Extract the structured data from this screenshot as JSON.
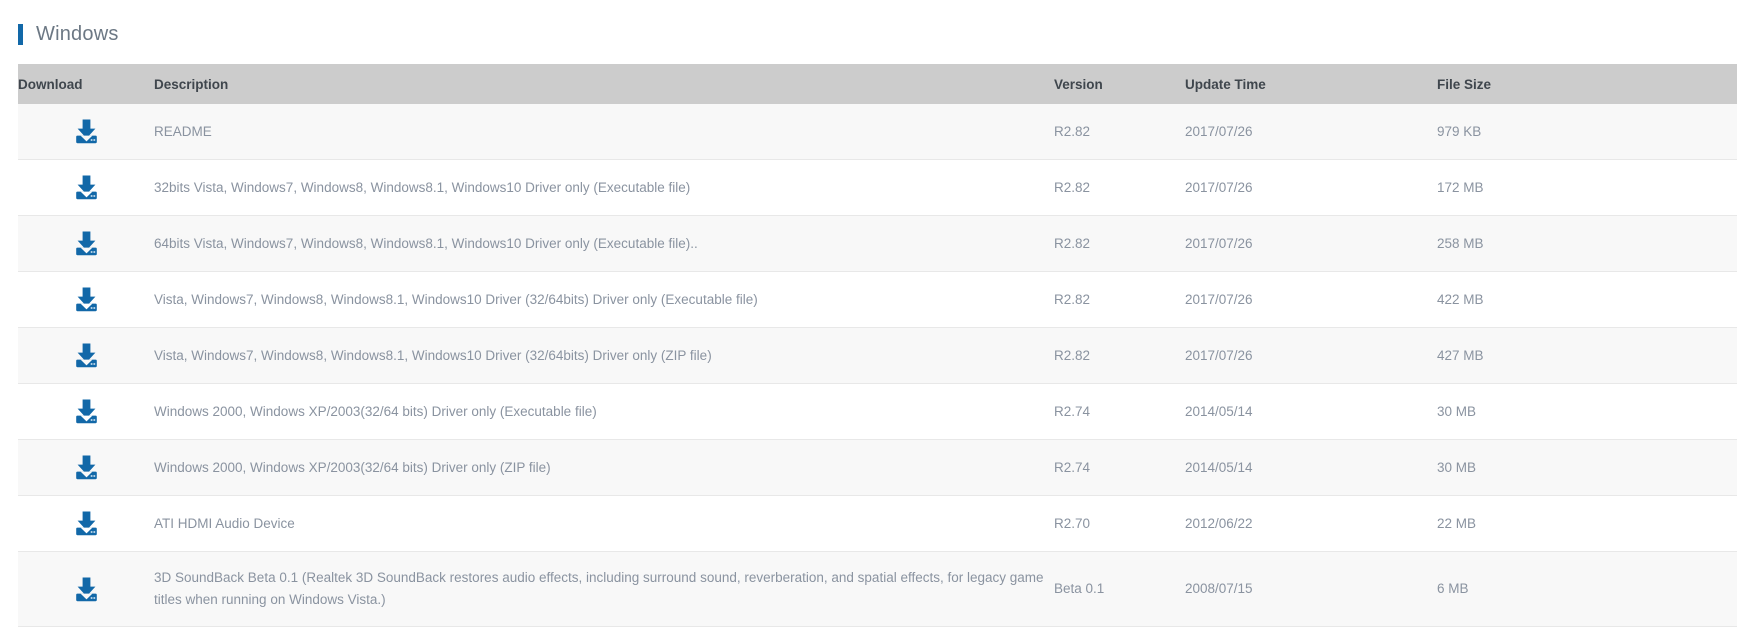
{
  "section": {
    "title": "Windows",
    "accent_color": "#1268a8"
  },
  "table": {
    "headers": {
      "download": "Download",
      "description": "Description",
      "version": "Version",
      "update_time": "Update Time",
      "file_size": "File Size"
    },
    "download_icon": "download-icon",
    "rows": [
      {
        "description": "README",
        "version": "R2.82",
        "update_time": "2017/07/26",
        "file_size": "979 KB"
      },
      {
        "description": "32bits Vista, Windows7, Windows8, Windows8.1, Windows10 Driver only (Executable file)",
        "version": "R2.82",
        "update_time": "2017/07/26",
        "file_size": "172 MB"
      },
      {
        "description": "64bits Vista, Windows7, Windows8, Windows8.1, Windows10 Driver only (Executable file)..",
        "version": "R2.82",
        "update_time": "2017/07/26",
        "file_size": "258 MB"
      },
      {
        "description": "Vista, Windows7, Windows8, Windows8.1, Windows10 Driver (32/64bits) Driver only (Executable file)",
        "version": "R2.82",
        "update_time": "2017/07/26",
        "file_size": "422 MB"
      },
      {
        "description": "Vista, Windows7, Windows8, Windows8.1, Windows10 Driver (32/64bits) Driver only (ZIP file)",
        "version": "R2.82",
        "update_time": "2017/07/26",
        "file_size": "427 MB"
      },
      {
        "description": "Windows 2000, Windows XP/2003(32/64 bits) Driver only (Executable file)",
        "version": "R2.74",
        "update_time": "2014/05/14",
        "file_size": "30 MB"
      },
      {
        "description": "Windows 2000, Windows XP/2003(32/64 bits) Driver only (ZIP file)",
        "version": "R2.74",
        "update_time": "2014/05/14",
        "file_size": "30 MB"
      },
      {
        "description": "ATI HDMI Audio Device",
        "version": "R2.70",
        "update_time": "2012/06/22",
        "file_size": "22 MB"
      },
      {
        "description": "3D SoundBack Beta 0.1 (Realtek 3D SoundBack restores audio effects, including surround sound, reverberation, and spatial effects, for legacy game titles when running on Windows Vista.)",
        "version": "Beta 0.1",
        "update_time": "2008/07/15",
        "file_size": "6 MB"
      }
    ]
  }
}
